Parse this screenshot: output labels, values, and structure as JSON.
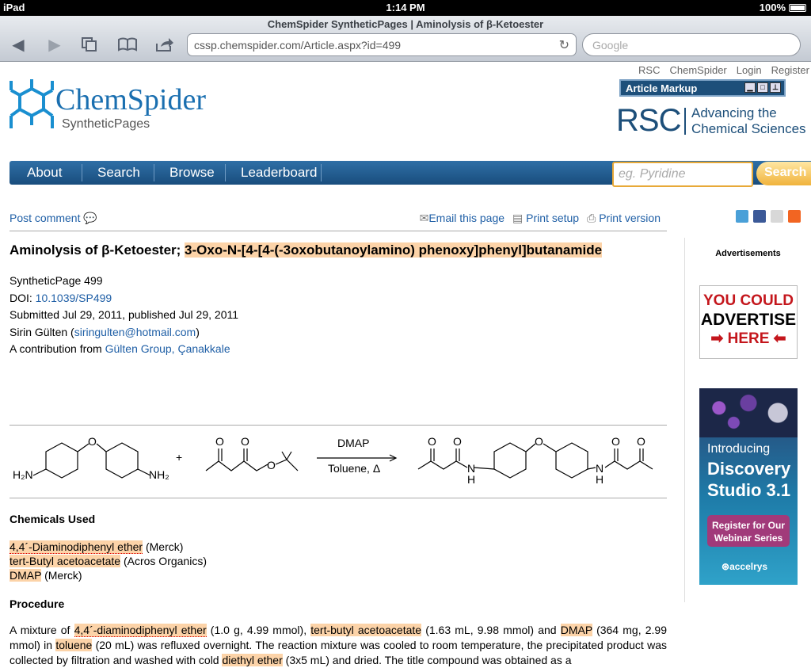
{
  "status": {
    "device": "iPad",
    "time": "1:14 PM",
    "battery": "100%"
  },
  "browser": {
    "page_title": "ChemSpider SyntheticPages | Aminolysis of β-Ketoester",
    "url": "cssp.chemspider.com/Article.aspx?id=499",
    "search_placeholder": "Google"
  },
  "header": {
    "top_links": [
      "RSC",
      "ChemSpider",
      "Login",
      "Register"
    ],
    "logo_name": "ChemSpider",
    "logo_sub": "SyntheticPages",
    "article_markup": "Article Markup",
    "rsc_big": "RSC",
    "rsc_tag_line1": "Advancing the",
    "rsc_tag_line2": "Chemical Sciences"
  },
  "nav": {
    "items": [
      "About",
      "Search",
      "Browse",
      "Leaderboard"
    ],
    "search_placeholder": "eg. Pyridine",
    "search_button": "Search"
  },
  "actions": {
    "post_comment": "Post comment",
    "email": "Email this page",
    "print_setup": "Print setup",
    "print_version": "Print version"
  },
  "article": {
    "title_plain": "Aminolysis of β-Ketoester",
    "title_sep": "; ",
    "title_compound": "3-Oxo-N-[4-[4-(-3oxobutanoylamino) phenoxy]phenyl]butanamide",
    "page_id": "SyntheticPage 499",
    "doi_label": "DOI: ",
    "doi": "10.1039/SP499",
    "dates": "Submitted Jul 29, 2011, published Jul 29, 2011",
    "author": "Sirin Gülten (",
    "author_email": "siringulten@hotmail.com",
    "author_close": ")",
    "contribution_label": "A contribution from ",
    "contribution": "Gülten Group, Çanakkale",
    "reaction": {
      "plus": "+",
      "reagent": "DMAP",
      "conditions": "Toluene, Δ",
      "nh2_left": "H₂N",
      "nh2_right": "NH₂",
      "o": "O",
      "nh": "N",
      "h": "H"
    },
    "chemicals_heading": "Chemicals Used",
    "chemicals": [
      {
        "name": "4,4´-Diaminodiphenyl ether",
        "supplier": " (Merck)"
      },
      {
        "name": "tert-Butyl acetoacetate",
        "supplier": " (Acros Organics)"
      },
      {
        "name": "DMAP",
        "supplier": " (Merck)"
      }
    ],
    "procedure_heading": "Procedure",
    "procedure": {
      "p1": "A mixture of ",
      "c1": "4,4´-diaminodiphenyl ether",
      "p2": " (1.0 g, 4.99 mmol), ",
      "c2": "tert-butyl acetoacetate",
      "p3": " (1.63 mL, 9.98 mmol) and ",
      "c3": "DMAP",
      "p4": " (364 mg, 2.99 mmol) in ",
      "c4": "toluene",
      "p5": " (20 mL) was refluxed overnight. The reaction mixture was cooled to room temperature, the precipitated product was collected by filtration and washed with cold ",
      "c5": "diethyl ether",
      "p6": " (3x5 mL) and dried. The title compound was obtained as a"
    }
  },
  "ads": {
    "heading": "Advertisements",
    "adv1": "YOU COULD",
    "adv2": "ADVERTISE",
    "adv3": "HERE",
    "ds1": "Introducing",
    "ds2": "Discovery",
    "ds3": "Studio 3.1",
    "ds_btn1": "Register for Our",
    "ds_btn2": "Webinar Series",
    "ds_brand": "accelrys"
  }
}
